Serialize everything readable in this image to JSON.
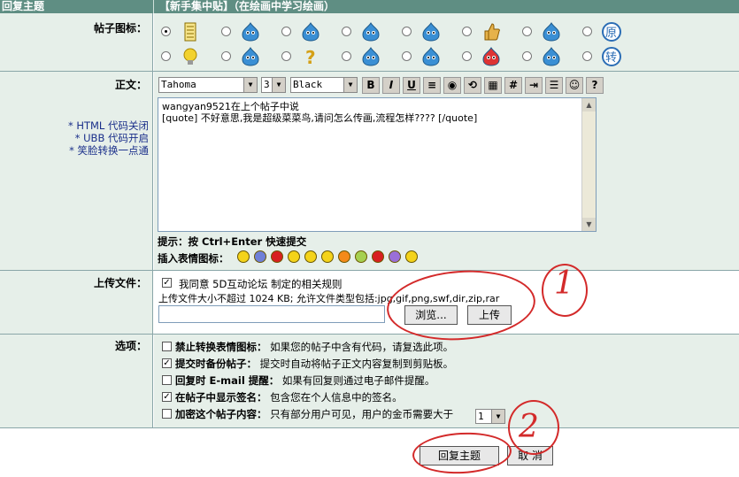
{
  "header": {
    "left": "回复主题",
    "right": "【新手集中贴】（在绘画中学习绘画）"
  },
  "icons": {
    "label": "帖子图标：",
    "items": [
      {
        "name": "notepad-icon",
        "color": "#c9a227",
        "selected": true
      },
      {
        "name": "blue-blob-icon",
        "color": "#3a8fd4"
      },
      {
        "name": "blue-blob-icon",
        "color": "#3a8fd4"
      },
      {
        "name": "blue-blob-icon",
        "color": "#3a8fd4"
      },
      {
        "name": "blue-blob-sunglasses-icon",
        "color": "#3a8fd4"
      },
      {
        "name": "thumbs-up-icon",
        "color": "#e6b24a"
      },
      {
        "name": "blue-blob-icon",
        "color": "#3a8fd4"
      },
      {
        "name": "yuan-badge-icon",
        "color": "#2b6db5",
        "text": "原"
      },
      {
        "name": "lightbulb-icon",
        "color": "#f2d22e"
      },
      {
        "name": "blue-blob-icon",
        "color": "#3a8fd4"
      },
      {
        "name": "question-mark-icon",
        "color": "#d4a017"
      },
      {
        "name": "blue-blob-icon",
        "color": "#3a8fd4"
      },
      {
        "name": "blue-blob-icon",
        "color": "#3a8fd4"
      },
      {
        "name": "red-angry-blob-icon",
        "color": "#d33"
      },
      {
        "name": "blue-blob-icon",
        "color": "#3a8fd4"
      },
      {
        "name": "zhuan-badge-icon",
        "color": "#2b6db5",
        "text": "转"
      }
    ]
  },
  "body": {
    "label": "正文：",
    "notes": [
      "* HTML 代码关闭",
      "* UBB  代码开启",
      "* 笑脸转换一点通"
    ],
    "font": "Tahoma",
    "size": "3",
    "color": "Black",
    "toolbar": [
      "B",
      "I",
      "U",
      "≡",
      "◉",
      "⟲",
      "▦",
      "#",
      "⇥",
      "☰",
      "☺",
      "?"
    ],
    "text_line1": "wangyan9521在上个帖子中说",
    "text_line2": "[quote] 不好意思,我是超级菜菜鸟,请问怎么传画,流程怎样???? [/quote]",
    "hint": "提示：按 Ctrl+Enter 快速提交",
    "emote_label": "插入表情图标：",
    "emotes": [
      "#f4d31a",
      "#6f80d8",
      "#d82020",
      "#f4d31a",
      "#f4d31a",
      "#f4d31a",
      "#f48a1a",
      "#a6d050",
      "#d82020",
      "#9a6fd8",
      "#f4d31a"
    ]
  },
  "upload": {
    "label": "上传文件：",
    "agree": "我同意 5D互动论坛 制定的相关规则",
    "limit": "上传文件大小不超过 1024 KB; 允许文件类型包括:jpg,gif,png,swf,dir,zip,rar",
    "browse": "浏览...",
    "upload": "上传",
    "annotation": "1"
  },
  "options": {
    "label": "选项：",
    "items": [
      {
        "title": "禁止转换表情图标：",
        "desc": "如果您的帖子中含有代码，请复选此项。",
        "checked": false
      },
      {
        "title": "提交时备份帖子：",
        "desc": "提交时自动将帖子正文内容复制到剪贴板。",
        "checked": true
      },
      {
        "title": "回复时 E-mail 提醒：",
        "desc": "如果有回复则通过电子邮件提醒。",
        "checked": false
      },
      {
        "title": "在帖子中显示签名：",
        "desc": "包含您在个人信息中的签名。",
        "checked": true
      },
      {
        "title": "加密这个帖子内容：",
        "desc": "只有部分用户可见，用户的金币需要大于",
        "checked": false
      }
    ],
    "coin_value": "1"
  },
  "actions": {
    "submit": "回复主题",
    "cancel": "取 消",
    "annotation": "2"
  }
}
